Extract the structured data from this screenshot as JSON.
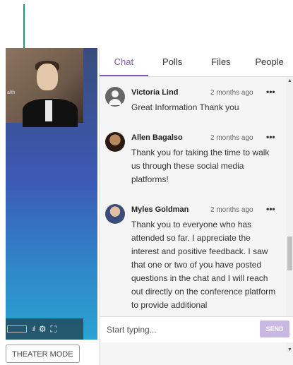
{
  "video": {
    "cam_tag": "alth",
    "signal_glyph": ".ıl",
    "settings_icon": "gear-icon",
    "fullscreen_icon": "fullscreen-icon"
  },
  "theater_mode_label": "THEATER MODE",
  "tabs": [
    {
      "label": "Chat",
      "active": true
    },
    {
      "label": "Polls",
      "active": false
    },
    {
      "label": "Files",
      "active": false
    },
    {
      "label": "People",
      "active": false
    }
  ],
  "messages": [
    {
      "name": "Victoria Lind",
      "time": "2 months ago",
      "text": "Great Information Thank you",
      "avatar": "generic"
    },
    {
      "name": "Allen Bagalso",
      "time": "2 months ago",
      "text": "Thank you for taking the time to walk us through these social media platforms!",
      "avatar": "photo"
    },
    {
      "name": "Myles Goldman",
      "time": "2 months ago",
      "text": "Thank you to everyone who has attended so far. I appreciate the interest and positive feedback. I saw that one or two of you have posted questions in the chat and I will reach out directly on the conference platform to provide additional",
      "avatar": "photo"
    }
  ],
  "more_glyph": "•••",
  "composer": {
    "placeholder": "Start typing...",
    "send_label": "SEND"
  },
  "colors": {
    "accent": "#7b5ea7",
    "callout": "#1a9e6a",
    "send": "#c9b8e3"
  }
}
